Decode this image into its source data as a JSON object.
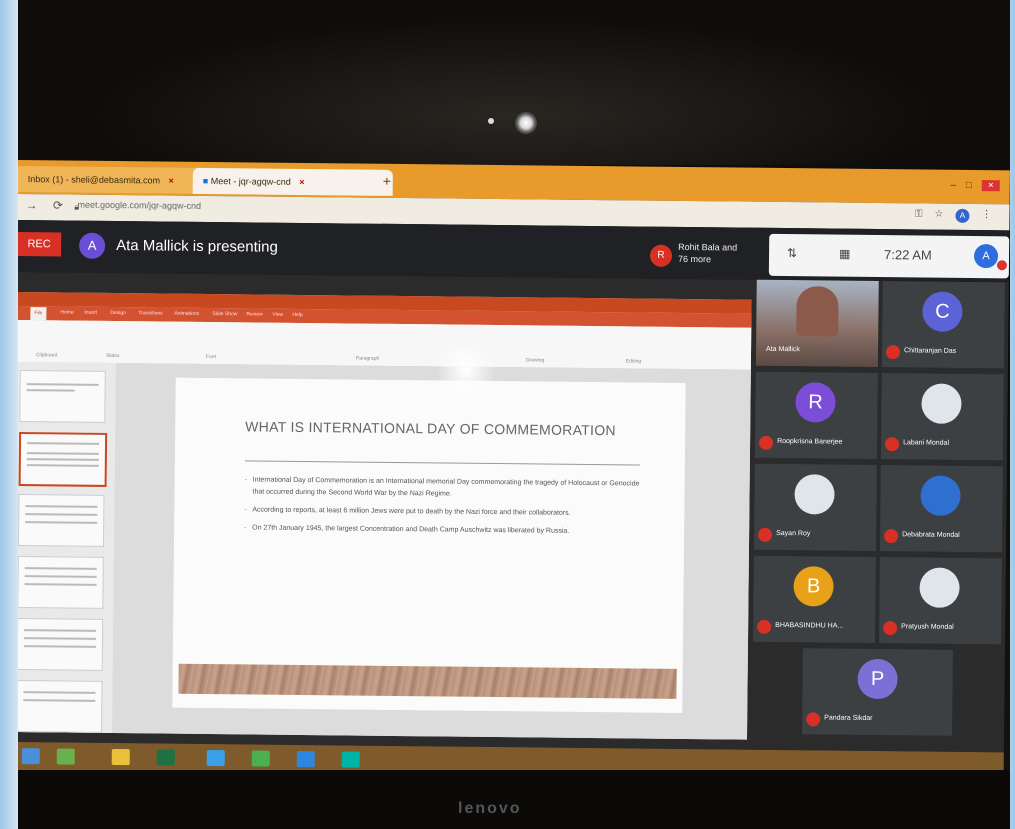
{
  "browser": {
    "tabs": [
      {
        "label": "Inbox (1) - sheli@debasmita.com"
      },
      {
        "label": "Meet - jqr-agqw-cnd"
      }
    ],
    "new_tab": "+",
    "url": "meet.google.com/jqr-agqw-cnd",
    "account_initial": "A"
  },
  "meet": {
    "rec_label": "REC",
    "presenter_initial": "A",
    "presenting_text": "Ata Mallick is presenting",
    "people_initial": "R",
    "people_text": "Rohit Bala and 76 more",
    "status_time": "7:22 AM",
    "status_avatar": "A"
  },
  "powerpoint": {
    "ribbon_tabs": [
      "File",
      "Home",
      "Insert",
      "Design",
      "Transitions",
      "Animations",
      "Slide Show",
      "Review",
      "View",
      "Help"
    ],
    "ribbon_groups": [
      "Clipboard",
      "Slides",
      "Font",
      "Paragraph",
      "Drawing",
      "Editing"
    ]
  },
  "slide": {
    "title": "WHAT IS INTERNATIONAL DAY OF COMMEMORATION",
    "bullets": [
      "International Day of Commemoration is an International memorial Day commemorating the tragedy of Holocaust or Genocide that occurred during the Second World War by the Nazi Regime.",
      "According to reports, at least 6 million Jews were put to death by the Nazi force and their collaborators.",
      "On 27th January 1945, the largest Concentration and Death Camp Auschwitz was liberated by Russia."
    ]
  },
  "participants": [
    {
      "name": "Ata Mallick",
      "initial": "",
      "color": "#000000",
      "type": "video"
    },
    {
      "name": "Chittaranjan Das",
      "initial": "C",
      "color": "#5b63d6",
      "type": "avatar"
    },
    {
      "name": "Roopkrisna Banerjee",
      "initial": "R",
      "color": "#7c4dd6",
      "type": "avatar"
    },
    {
      "name": "Labani Mondal",
      "initial": "",
      "color": "#dfe5ea",
      "type": "photo"
    },
    {
      "name": "Sayan Roy",
      "initial": "",
      "color": "#dfe5ea",
      "type": "photo"
    },
    {
      "name": "Debabrata Mondal",
      "initial": "",
      "color": "#2e6fd0",
      "type": "photo"
    },
    {
      "name": "BHABASINDHU HA...",
      "initial": "B",
      "color": "#e8a21a",
      "type": "avatar"
    },
    {
      "name": "Pratyush Mondal",
      "initial": "",
      "color": "#dfe5ea",
      "type": "photo"
    },
    {
      "name": "Pandara Sikdar",
      "initial": "P",
      "color": "#7c6fd6",
      "type": "avatar"
    }
  ],
  "laptop": {
    "brand": "lenovo"
  }
}
